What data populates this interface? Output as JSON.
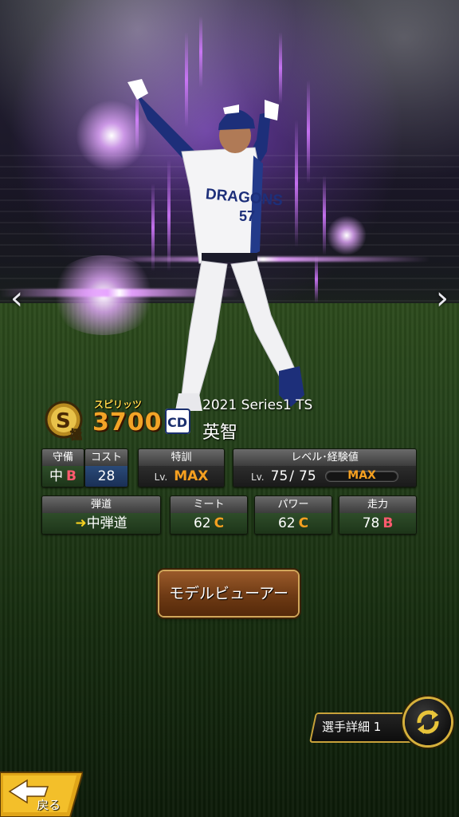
{
  "nav": {
    "prev_glyph": "‹",
    "next_glyph": "›"
  },
  "card": {
    "rank": "S",
    "rank_sub": "極",
    "spirits_label": "スピリッツ",
    "spirits_value": "3700",
    "series": "2021 Series1 TS",
    "player_name": "英智",
    "jersey_team": "DRAGONS",
    "jersey_number": "57",
    "team_logo_text": "CD"
  },
  "stats": {
    "defense": {
      "label": "守備",
      "position": "中",
      "grade": "B"
    },
    "cost": {
      "label": "コスト",
      "value": "28"
    },
    "special_training": {
      "label": "特訓",
      "lv": "Lv.",
      "value": "MAX"
    },
    "level_exp": {
      "label": "レベル･経験値",
      "lv": "Lv.",
      "current": "75",
      "separator": "/",
      "max": "75",
      "exp_label": "MAX"
    },
    "trajectory": {
      "label": "弾道",
      "value": "中弾道"
    },
    "meet": {
      "label": "ミート",
      "value": "62",
      "grade": "C"
    },
    "power": {
      "label": "パワー",
      "value": "62",
      "grade": "C"
    },
    "speed": {
      "label": "走力",
      "value": "78",
      "grade": "B"
    }
  },
  "buttons": {
    "model_viewer": "モデルビューアー",
    "player_detail": "選手詳細 1",
    "back": "戻る"
  },
  "icons": {
    "prev": "chevron-left-icon",
    "next": "chevron-right-icon",
    "switch": "switch-arrows-icon",
    "back": "back-arrow-icon",
    "trajectory": "trajectory-arrow-icon"
  },
  "colors": {
    "grade_b": "#ff5a6e",
    "grade_c": "#f5a020",
    "max": "#f5a020",
    "spirits": "#f3a427",
    "gold_accent": "#d6b03c"
  }
}
